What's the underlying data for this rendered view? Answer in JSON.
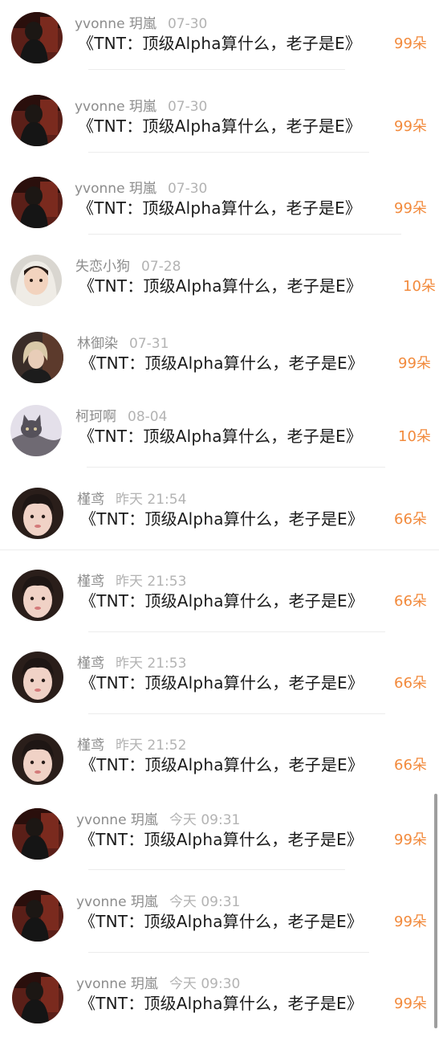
{
  "rows": [
    {
      "user": "yvonne 玥嵐",
      "time": "07-30",
      "message": "《TNT：顶级Alpha算什么，老子是E》",
      "gift": "99朵",
      "avatar": "dark-figure-avatar"
    },
    {
      "user": "yvonne 玥嵐",
      "time": "07-30",
      "message": "《TNT：顶级Alpha算什么，老子是E》",
      "gift": "99朵",
      "avatar": "dark-figure-avatar"
    },
    {
      "user": "yvonne 玥嵐",
      "time": "07-30",
      "message": "《TNT：顶级Alpha算什么，老子是E》",
      "gift": "99朵",
      "avatar": "dark-figure-avatar"
    },
    {
      "user": "失恋小狗",
      "time": "07-28",
      "message": "《TNT：顶级Alpha算什么，老子是E》",
      "gift": "10朵",
      "avatar": "girl-hood-avatar"
    },
    {
      "user": "林御染",
      "time": "07-31",
      "message": "《TNT：顶级Alpha算什么，老子是E》",
      "gift": "99朵",
      "avatar": "blonde-person-avatar"
    },
    {
      "user": "柯珂啊",
      "time": "08-04",
      "message": "《TNT：顶级Alpha算什么，老子是E》",
      "gift": "10朵",
      "avatar": "cat-avatar"
    },
    {
      "user": "槿鸢",
      "time": "昨天 21:54",
      "message": "《TNT：顶级Alpha算什么，老子是E》",
      "gift": "66朵",
      "avatar": "girl-face-avatar"
    },
    {
      "user": "槿鸢",
      "time": "昨天 21:53",
      "message": "《TNT：顶级Alpha算什么，老子是E》",
      "gift": "66朵",
      "avatar": "girl-face-avatar"
    },
    {
      "user": "槿鸢",
      "time": "昨天 21:53",
      "message": "《TNT：顶级Alpha算什么，老子是E》",
      "gift": "66朵",
      "avatar": "girl-face-avatar"
    },
    {
      "user": "槿鸢",
      "time": "昨天 21:52",
      "message": "《TNT：顶级Alpha算什么，老子是E》",
      "gift": "66朵",
      "avatar": "girl-face-avatar"
    },
    {
      "user": "yvonne 玥嵐",
      "time": "今天 09:31",
      "message": "《TNT：顶级Alpha算什么，老子是E》",
      "gift": "99朵",
      "avatar": "dark-figure-avatar"
    },
    {
      "user": "yvonne 玥嵐",
      "time": "今天 09:31",
      "message": "《TNT：顶级Alpha算什么，老子是E》",
      "gift": "99朵",
      "avatar": "dark-figure-avatar"
    },
    {
      "user": "yvonne 玥嵐",
      "time": "今天 09:30",
      "message": "《TNT：顶级Alpha算什么，老子是E》",
      "gift": "99朵",
      "avatar": "dark-figure-avatar"
    }
  ],
  "colors": {
    "gift": "#f28a3c",
    "username": "#8c8c8c",
    "time": "#b3b3b3",
    "message": "#1a1a1a"
  }
}
